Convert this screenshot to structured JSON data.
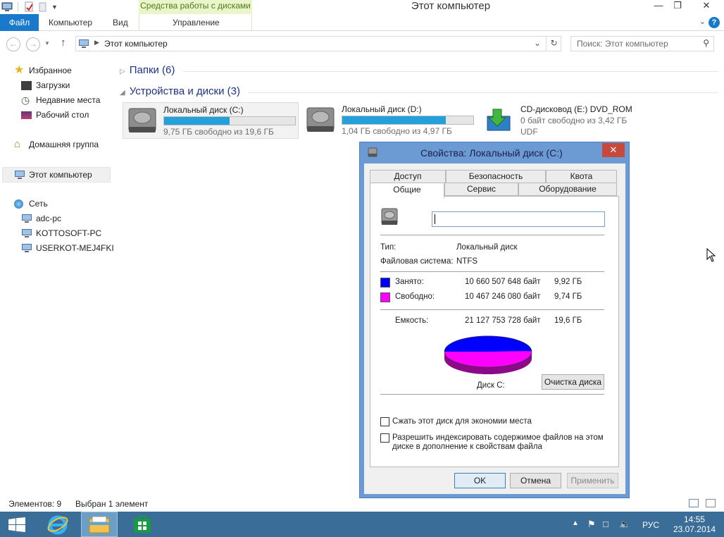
{
  "titlebar": {
    "title": "Этот компьютер",
    "context_tab_group": "Средства работы с дисками"
  },
  "ribbon": {
    "tabs": [
      "Файл",
      "Компьютер",
      "Вид",
      "Управление"
    ]
  },
  "address": {
    "path": "Этот компьютер",
    "search_placeholder": "Поиск: Этот компьютер"
  },
  "sidebar": {
    "favorites": "Избранное",
    "favorites_items": [
      "Загрузки",
      "Недавние места",
      "Рабочий стол"
    ],
    "homegroup": "Домашняя группа",
    "this_pc": "Этот компьютер",
    "network": "Сеть",
    "network_items": [
      "adc-pc",
      "KOTTOSOFT-PC",
      "USERKOT-MEJ4FKI"
    ]
  },
  "content": {
    "folders_group": "Папки (6)",
    "devices_group": "Устройства и диски (3)",
    "drives": [
      {
        "name": "Локальный диск (C:)",
        "free": "9,75 ГБ свободно из 19,6 ГБ",
        "used_fraction": 0.5
      },
      {
        "name": "Локальный диск (D:)",
        "free": "1,04 ГБ свободно из 4,97 ГБ",
        "used_fraction": 0.79
      }
    ],
    "cd": {
      "name": "CD-дисковод (E:) DVD_ROM",
      "free": "0 байт свободно из 3,42 ГБ",
      "fs": "UDF"
    }
  },
  "status": {
    "items": "Элементов: 9",
    "selected": "Выбран 1 элемент"
  },
  "dialog": {
    "title": "Свойства: Локальный диск (C:)",
    "tabs_row1": [
      "Доступ",
      "Безопасность",
      "Квота"
    ],
    "tabs_row2": [
      "Общие",
      "Сервис",
      "Оборудование"
    ],
    "type_label": "Тип:",
    "type_value": "Локальный диск",
    "fs_label": "Файловая система:",
    "fs_value": "NTFS",
    "used_label": "Занято:",
    "used_bytes": "10 660 507 648 байт",
    "used_gb": "9,92 ГБ",
    "free_label": "Свободно:",
    "free_bytes": "10 467 246 080 байт",
    "free_gb": "9,74 ГБ",
    "capacity_label": "Емкость:",
    "capacity_bytes": "21 127 753 728 байт",
    "capacity_gb": "19,6 ГБ",
    "disk_label": "Диск C:",
    "cleanup_button": "Очистка диска",
    "compress_label": "Сжать этот диск для экономии места",
    "index_label_line1": "Разрешить индексировать содержимое файлов на этом",
    "index_label_line2": "диске в дополнение к свойствам файла",
    "ok": "OK",
    "cancel": "Отмена",
    "apply": "Применить",
    "used_color": "#0000ff",
    "free_color": "#ff00ff"
  },
  "taskbar": {
    "lang": "РУС",
    "time": "14:55",
    "date": "23.07.2014"
  }
}
